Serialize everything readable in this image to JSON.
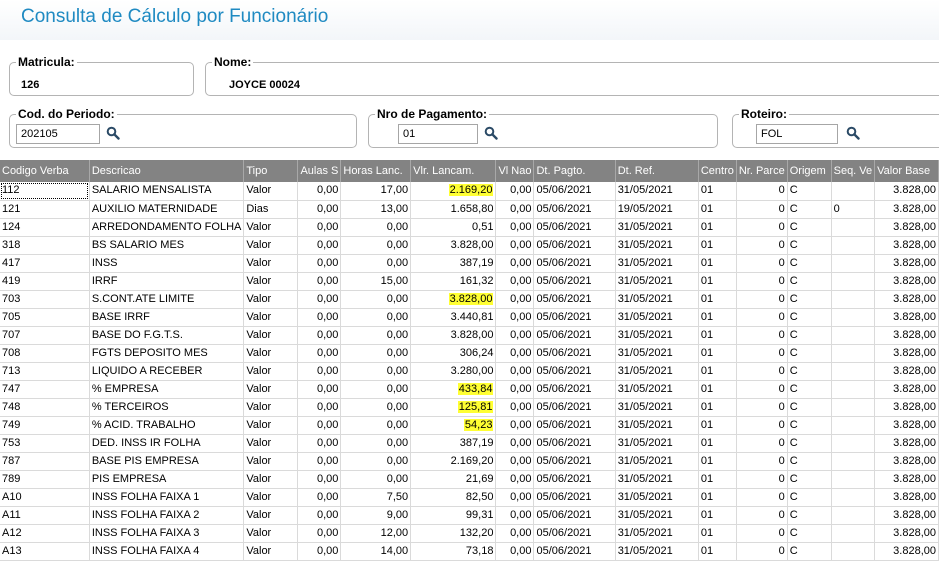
{
  "title": "Consulta de Cálculo por Funcionário",
  "matricula": {
    "label": "Matricula:",
    "value": "126"
  },
  "nome": {
    "label": "Nome:",
    "value": "JOYCE 00024"
  },
  "periodo": {
    "label": "Cod. do Periodo:",
    "value": "202105"
  },
  "pagamento": {
    "label": "Nro de Pagamento:",
    "value": "01"
  },
  "roteiro": {
    "label": "Roteiro:",
    "value": "FOL"
  },
  "highlight_color": "#ffff33",
  "header_color": "#838383",
  "columns": [
    "Codigo Verba",
    "Descricao",
    "Tipo",
    "Aulas S",
    "Horas Lanc.",
    "Vlr. Lancam.",
    "Vl Nao",
    "Dt. Pagto.",
    "Dt. Ref.",
    "Centro",
    "Nr. Parce",
    "Origem",
    "Seq. Ve",
    "Valor Base"
  ],
  "rows": [
    {
      "c": [
        "112",
        "SALARIO MENSALISTA",
        "Valor",
        "0,00",
        "17,00",
        "2.169,20",
        "0,00",
        "05/06/2021",
        "31/05/2021",
        "01",
        "0",
        "C",
        "",
        "3.828,00"
      ],
      "hl": true
    },
    {
      "c": [
        "121",
        "AUXILIO MATERNIDADE",
        "Dias",
        "0,00",
        "13,00",
        "1.658,80",
        "0,00",
        "05/06/2021",
        "19/05/2021",
        "01",
        "0",
        "C",
        "0",
        "3.828,00"
      ],
      "hl": false
    },
    {
      "c": [
        "124",
        "ARREDONDAMENTO FOLHA",
        "Valor",
        "0,00",
        "0,00",
        "0,51",
        "0,00",
        "05/06/2021",
        "31/05/2021",
        "01",
        "0",
        "C",
        "",
        "3.828,00"
      ],
      "hl": false
    },
    {
      "c": [
        "318",
        "BS SALARIO MES",
        "Valor",
        "0,00",
        "0,00",
        "3.828,00",
        "0,00",
        "05/06/2021",
        "31/05/2021",
        "01",
        "0",
        "C",
        "",
        "3.828,00"
      ],
      "hl": false
    },
    {
      "c": [
        "417",
        "INSS",
        "Valor",
        "0,00",
        "0,00",
        "387,19",
        "0,00",
        "05/06/2021",
        "31/05/2021",
        "01",
        "0",
        "C",
        "",
        "3.828,00"
      ],
      "hl": false
    },
    {
      "c": [
        "419",
        "IRRF",
        "Valor",
        "0,00",
        "15,00",
        "161,32",
        "0,00",
        "05/06/2021",
        "31/05/2021",
        "01",
        "0",
        "C",
        "",
        "3.828,00"
      ],
      "hl": false
    },
    {
      "c": [
        "703",
        "S.CONT.ATE LIMITE",
        "Valor",
        "0,00",
        "0,00",
        "3.828,00",
        "0,00",
        "05/06/2021",
        "31/05/2021",
        "01",
        "0",
        "C",
        "",
        "3.828,00"
      ],
      "hl": true
    },
    {
      "c": [
        "705",
        "BASE IRRF",
        "Valor",
        "0,00",
        "0,00",
        "3.440,81",
        "0,00",
        "05/06/2021",
        "31/05/2021",
        "01",
        "0",
        "C",
        "",
        "3.828,00"
      ],
      "hl": false
    },
    {
      "c": [
        "707",
        "BASE DO F.G.T.S.",
        "Valor",
        "0,00",
        "0,00",
        "3.828,00",
        "0,00",
        "05/06/2021",
        "31/05/2021",
        "01",
        "0",
        "C",
        "",
        "3.828,00"
      ],
      "hl": false
    },
    {
      "c": [
        "708",
        "FGTS DEPOSITO MES",
        "Valor",
        "0,00",
        "0,00",
        "306,24",
        "0,00",
        "05/06/2021",
        "31/05/2021",
        "01",
        "0",
        "C",
        "",
        "3.828,00"
      ],
      "hl": false
    },
    {
      "c": [
        "713",
        "LIQUIDO A RECEBER",
        "Valor",
        "0,00",
        "0,00",
        "3.280,00",
        "0,00",
        "05/06/2021",
        "31/05/2021",
        "01",
        "0",
        "C",
        "",
        "3.828,00"
      ],
      "hl": false
    },
    {
      "c": [
        "747",
        "% EMPRESA",
        "Valor",
        "0,00",
        "0,00",
        "433,84",
        "0,00",
        "05/06/2021",
        "31/05/2021",
        "01",
        "0",
        "C",
        "",
        "3.828,00"
      ],
      "hl": true
    },
    {
      "c": [
        "748",
        "% TERCEIROS",
        "Valor",
        "0,00",
        "0,00",
        "125,81",
        "0,00",
        "05/06/2021",
        "31/05/2021",
        "01",
        "0",
        "C",
        "",
        "3.828,00"
      ],
      "hl": true
    },
    {
      "c": [
        "749",
        "% ACID. TRABALHO",
        "Valor",
        "0,00",
        "0,00",
        "54,23",
        "0,00",
        "05/06/2021",
        "31/05/2021",
        "01",
        "0",
        "C",
        "",
        "3.828,00"
      ],
      "hl": true
    },
    {
      "c": [
        "753",
        "DED. INSS IR FOLHA",
        "Valor",
        "0,00",
        "0,00",
        "387,19",
        "0,00",
        "05/06/2021",
        "31/05/2021",
        "01",
        "0",
        "C",
        "",
        "3.828,00"
      ],
      "hl": false
    },
    {
      "c": [
        "787",
        "BASE PIS EMPRESA",
        "Valor",
        "0,00",
        "0,00",
        "2.169,20",
        "0,00",
        "05/06/2021",
        "31/05/2021",
        "01",
        "0",
        "C",
        "",
        "3.828,00"
      ],
      "hl": false
    },
    {
      "c": [
        "789",
        "PIS EMPRESA",
        "Valor",
        "0,00",
        "0,00",
        "21,69",
        "0,00",
        "05/06/2021",
        "31/05/2021",
        "01",
        "0",
        "C",
        "",
        "3.828,00"
      ],
      "hl": false
    },
    {
      "c": [
        "A10",
        "INSS FOLHA FAIXA 1",
        "Valor",
        "0,00",
        "7,50",
        "82,50",
        "0,00",
        "05/06/2021",
        "31/05/2021",
        "01",
        "0",
        "C",
        "",
        "3.828,00"
      ],
      "hl": false
    },
    {
      "c": [
        "A11",
        "INSS FOLHA FAIXA 2",
        "Valor",
        "0,00",
        "9,00",
        "99,31",
        "0,00",
        "05/06/2021",
        "31/05/2021",
        "01",
        "0",
        "C",
        "",
        "3.828,00"
      ],
      "hl": false
    },
    {
      "c": [
        "A12",
        "INSS FOLHA FAIXA 3",
        "Valor",
        "0,00",
        "12,00",
        "132,20",
        "0,00",
        "05/06/2021",
        "31/05/2021",
        "01",
        "0",
        "C",
        "",
        "3.828,00"
      ],
      "hl": false
    },
    {
      "c": [
        "A13",
        "INSS FOLHA FAIXA 4",
        "Valor",
        "0,00",
        "14,00",
        "73,18",
        "0,00",
        "05/06/2021",
        "31/05/2021",
        "01",
        "0",
        "C",
        "",
        "3.828,00"
      ],
      "hl": false
    }
  ]
}
